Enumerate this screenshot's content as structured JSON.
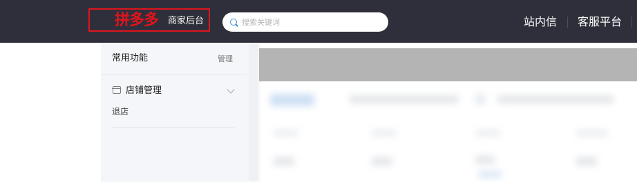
{
  "header": {
    "brand": "拼多多",
    "brand_subtitle": "商家后台",
    "search_placeholder": "搜索关键词",
    "nav": {
      "messages": "站内信",
      "service_platform": "客服平台"
    }
  },
  "sidebar": {
    "common_functions_title": "常用功能",
    "manage_label": "管理",
    "groups": [
      {
        "title": "店铺管理",
        "icon": "shop-icon",
        "items": [
          {
            "label": "退店"
          }
        ]
      }
    ]
  },
  "colors": {
    "topbar": "#2f2f3b",
    "brand_red": "#e0141c",
    "sidebar_bg": "#f5f6f9",
    "banner_placeholder": "#b4b4b4"
  }
}
